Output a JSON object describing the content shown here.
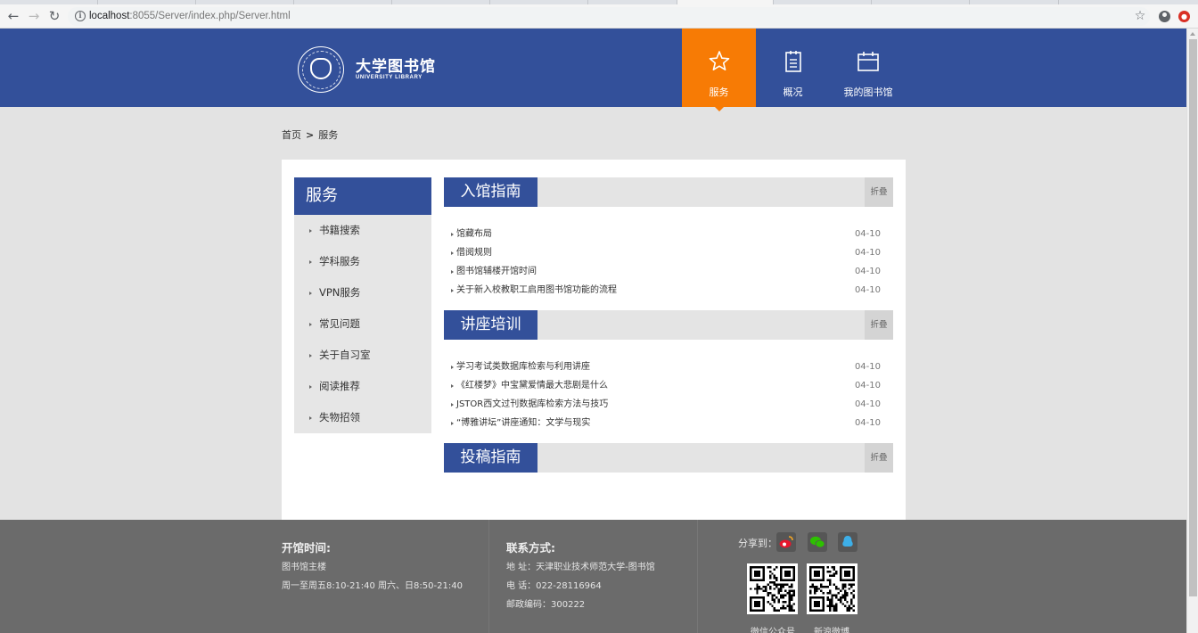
{
  "browser": {
    "url_host": "localhost",
    "url_rest": ":8055/Server/index.php/Server.html"
  },
  "header": {
    "logo_title": "大学图书馆",
    "logo_sub": "UNIVERSITY LIBRARY",
    "nav": [
      {
        "label": "服务",
        "icon": "star-icon",
        "active": true
      },
      {
        "label": "概况",
        "icon": "document-icon",
        "active": false
      },
      {
        "label": "我的图书馆",
        "icon": "calendar-icon",
        "active": false
      }
    ],
    "colors": {
      "primary": "#33509a",
      "accent": "#f77b05"
    }
  },
  "breadcrumb": {
    "home": "首页",
    "sep": ">",
    "current": "服务"
  },
  "sidebar": {
    "title": "服务",
    "items": [
      {
        "label": "书籍搜索"
      },
      {
        "label": "学科服务"
      },
      {
        "label": "VPN服务"
      },
      {
        "label": "常见问题"
      },
      {
        "label": "关于自习室"
      },
      {
        "label": "阅读推荐"
      },
      {
        "label": "失物招领"
      }
    ]
  },
  "sections": [
    {
      "title": "入馆指南",
      "fold": "折叠",
      "rows": [
        {
          "text": "馆藏布局",
          "date": "04-10"
        },
        {
          "text": "借阅规则",
          "date": "04-10"
        },
        {
          "text": "图书馆辅楼开馆时间",
          "date": "04-10"
        },
        {
          "text": "关于新入校教职工启用图书馆功能的流程",
          "date": "04-10"
        }
      ]
    },
    {
      "title": "讲座培训",
      "fold": "折叠",
      "rows": [
        {
          "text": "学习考试类数据库检索与利用讲座",
          "date": "04-10"
        },
        {
          "text": "《红楼梦》中宝黛爱情最大悲剧是什么",
          "date": "04-10"
        },
        {
          "text": "JSTOR西文过刊数据库检索方法与技巧",
          "date": "04-10"
        },
        {
          "text": "“博雅讲坛”讲座通知：文学与现实",
          "date": "04-10"
        }
      ]
    },
    {
      "title": "投稿指南",
      "fold": "折叠",
      "rows": []
    }
  ],
  "footer": {
    "hours": {
      "title": "开馆时间:",
      "line1": "图书馆主楼",
      "line2": "周一至周五8:10-21:40 周六、日8:50-21:40"
    },
    "contact": {
      "title": "联系方式:",
      "address": "地 址：天津职业技术师范大学-图书馆",
      "phone": "电 话：022-28116964",
      "postal": "邮政编码：300222"
    },
    "share": {
      "label": "分享到：",
      "buttons": [
        "weibo-icon",
        "wechat-icon",
        "qq-icon"
      ]
    },
    "qr": [
      {
        "caption": "微信公众号"
      },
      {
        "caption": "新浪微博"
      }
    ]
  }
}
